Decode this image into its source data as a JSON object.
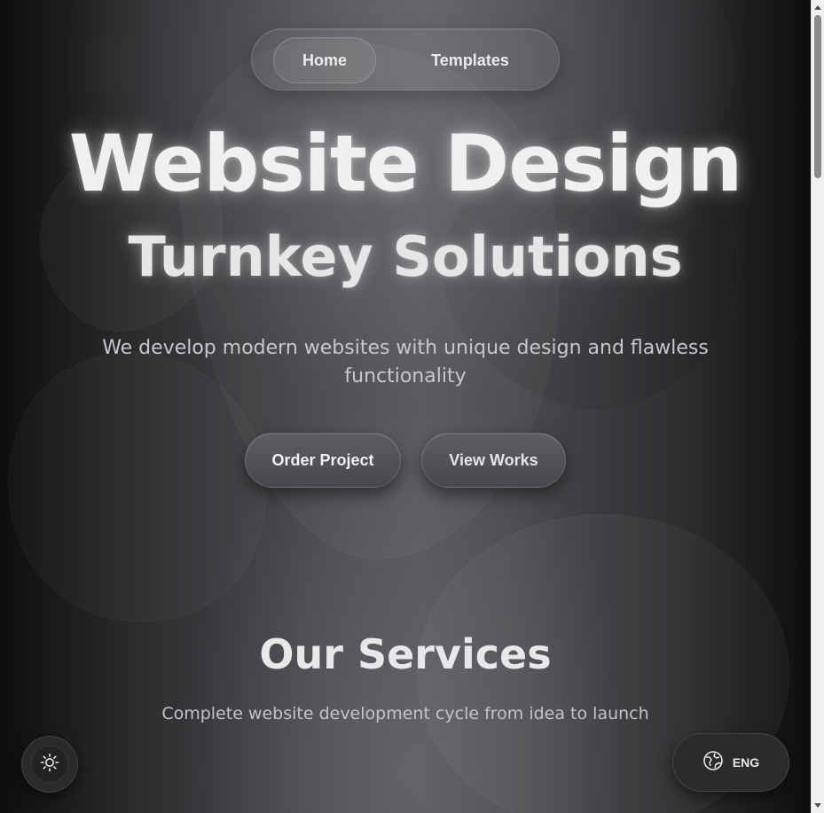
{
  "nav": {
    "items": [
      {
        "label": "Home",
        "active": true
      },
      {
        "label": "Templates",
        "active": false
      }
    ]
  },
  "hero": {
    "title": "Website Design",
    "subtitle": "Turnkey Solutions",
    "description": "We develop modern websites with unique design and flawless functionality",
    "primary_button": "Order Project",
    "secondary_button": "View Works"
  },
  "services": {
    "title": "Our Services",
    "description": "Complete website development cycle from idea to launch"
  },
  "controls": {
    "theme_icon": "sun-icon",
    "language_icon": "globe-icon",
    "language_label": "ENG"
  },
  "colors": {
    "background": "#4a4a4e",
    "text": "#f0f0f2",
    "button": "#55555a"
  }
}
